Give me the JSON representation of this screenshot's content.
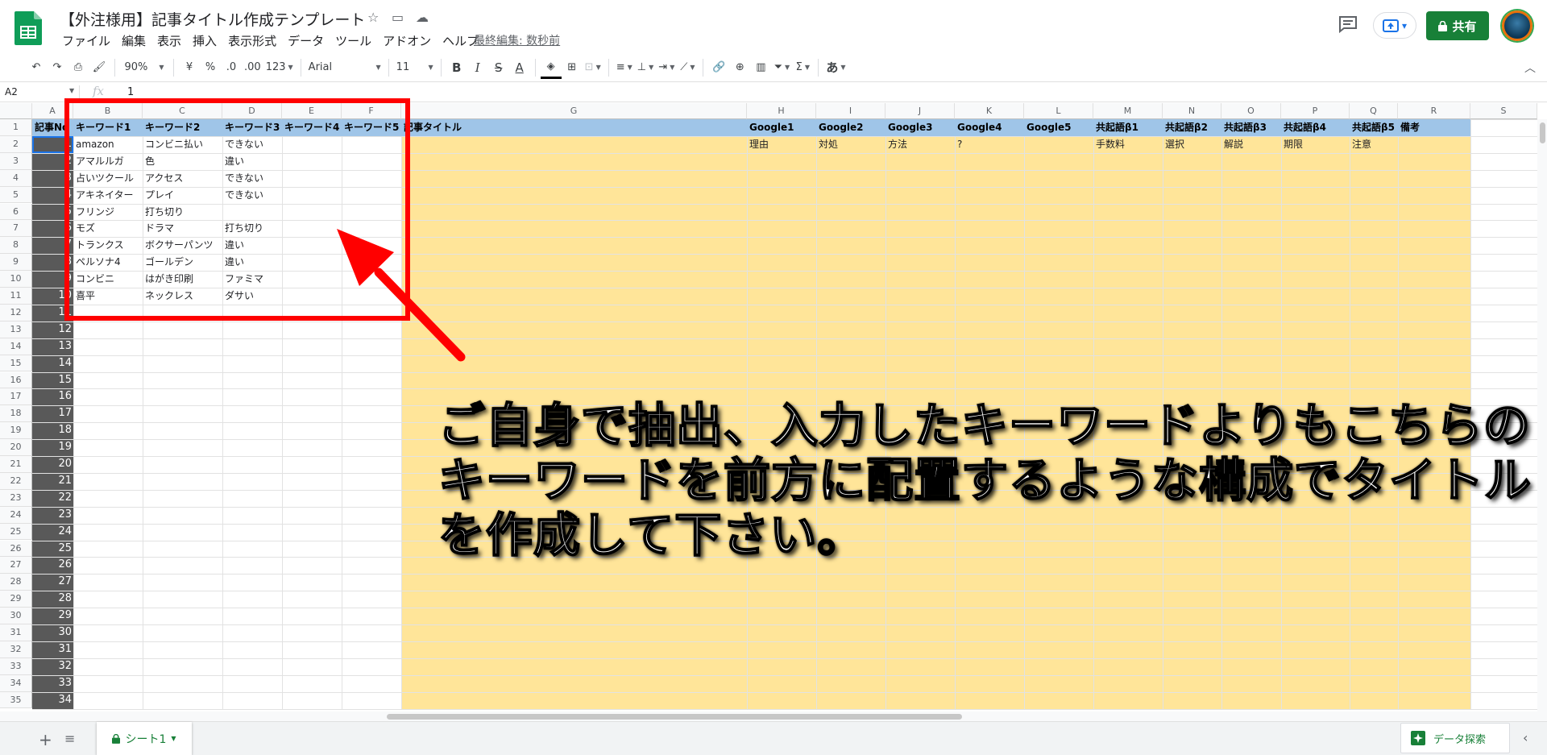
{
  "window": {
    "title": "【外注様用】記事タイトル作成テンプレート",
    "last_edit": "最終編集: 数秒前",
    "share_label": "共有"
  },
  "menu": [
    "ファイル",
    "編集",
    "表示",
    "挿入",
    "表示形式",
    "データ",
    "ツール",
    "アドオン",
    "ヘルプ"
  ],
  "toolbar": {
    "zoom": "90%",
    "currency": "¥",
    "percent": "%",
    "dec_decrease": ".0",
    "dec_increase": ".00",
    "format_more": "123",
    "font": "Arial",
    "font_size": "11",
    "bold": "B",
    "italic": "I",
    "strike": "S",
    "text_color": "A",
    "input_tools": "あ"
  },
  "formula_bar": {
    "name_box": "A2",
    "fx": "fx",
    "value": "1"
  },
  "columns": [
    "A",
    "B",
    "C",
    "D",
    "E",
    "F",
    "G",
    "H",
    "I",
    "J",
    "K",
    "L",
    "M",
    "N",
    "O",
    "P",
    "Q",
    "R",
    "S"
  ],
  "rows": [
    "1",
    "2",
    "3",
    "4",
    "5",
    "6",
    "7",
    "8",
    "9",
    "10",
    "11",
    "12",
    "13",
    "14",
    "15",
    "16",
    "17",
    "18",
    "19",
    "20",
    "21",
    "22",
    "23",
    "24",
    "25",
    "26",
    "27",
    "28",
    "29",
    "30",
    "31",
    "32",
    "33",
    "34",
    "35"
  ],
  "header_row": [
    "記事No",
    "キーワード1",
    "キーワード2",
    "キーワード3",
    "キーワード4",
    "キーワード5",
    "記事タイトル",
    "Google1",
    "Google2",
    "Google3",
    "Google4",
    "Google5",
    "共起語β1",
    "共起語β2",
    "共起語β3",
    "共起語β4",
    "共起語β5",
    "備考"
  ],
  "col_a_values": [
    "1",
    "2",
    "3",
    "4",
    "5",
    "6",
    "7",
    "8",
    "9",
    "10",
    "11",
    "12",
    "13",
    "14",
    "15",
    "16",
    "17",
    "18",
    "19",
    "20",
    "21",
    "22",
    "23",
    "24",
    "25",
    "26",
    "27",
    "28",
    "29",
    "30",
    "31",
    "32",
    "33",
    "34"
  ],
  "data_rows": [
    {
      "b": "amazon",
      "c": "コンビニ払い",
      "d": "できない"
    },
    {
      "b": "アマルルガ",
      "c": "色",
      "d": "違い"
    },
    {
      "b": "占いツクール",
      "c": "アクセス",
      "d": "できない"
    },
    {
      "b": "アキネイター",
      "c": "プレイ",
      "d": "できない"
    },
    {
      "b": "フリンジ",
      "c": "打ち切り",
      "d": ""
    },
    {
      "b": "モズ",
      "c": "ドラマ",
      "d": "打ち切り"
    },
    {
      "b": "トランクス",
      "c": "ボクサーパンツ",
      "d": "違い"
    },
    {
      "b": "ペルソナ4",
      "c": "ゴールデン",
      "d": "違い"
    },
    {
      "b": "コンビニ",
      "c": "はがき印刷",
      "d": "ファミマ"
    },
    {
      "b": "喜平",
      "c": "ネックレス",
      "d": "ダサい"
    }
  ],
  "row2_extra": [
    "理由",
    "対処",
    "方法",
    "?",
    "",
    "手数料",
    "選択",
    "解説",
    "期限",
    "注意"
  ],
  "overlay_text": [
    "ご自身で抽出、入力したキーワードよりもこちらの",
    "キーワードを前方に配置するような構成でタイトル",
    "を作成して下さい。"
  ],
  "sheet_tab": "シート1",
  "explore_label": "データ探索",
  "colors": {
    "header_blue": "#9fc5e8",
    "title_yellow": "#ffe599",
    "col_a_dark": "#595959",
    "annotation_red": "#ff0000",
    "share_green": "#188038"
  }
}
